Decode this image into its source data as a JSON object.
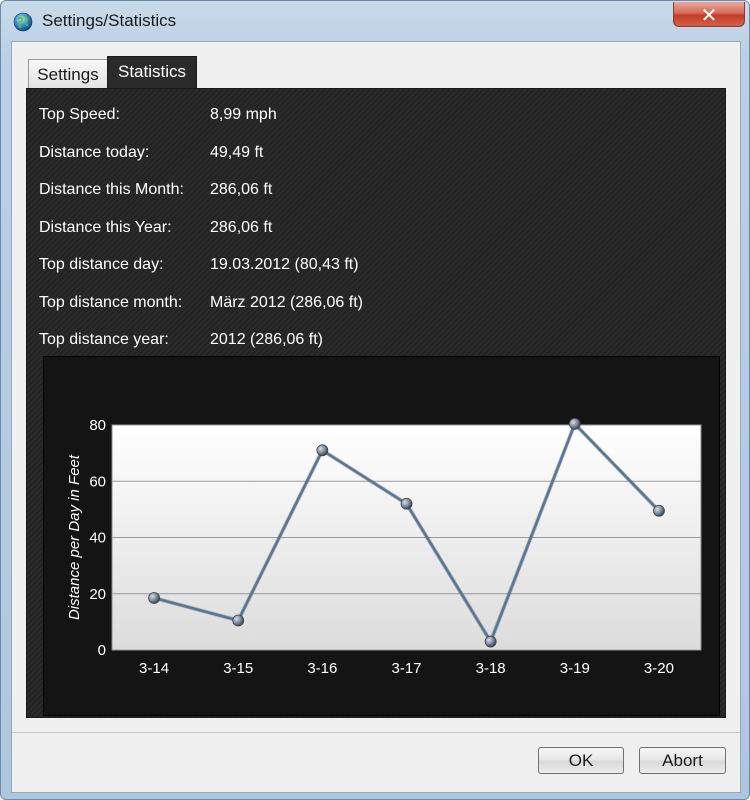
{
  "window": {
    "title": "Settings/Statistics",
    "close_glyph": "✕"
  },
  "tabs": [
    {
      "label": "Settings"
    },
    {
      "label": "Statistics"
    }
  ],
  "stats": [
    {
      "label": "Top Speed:",
      "value": "8,99 mph"
    },
    {
      "label": "Distance today:",
      "value": "49,49 ft"
    },
    {
      "label": "Distance this Month:",
      "value": "286,06 ft"
    },
    {
      "label": "Distance this Year:",
      "value": "286,06 ft"
    },
    {
      "label": "Top distance day:",
      "value": "19.03.2012 (80,43 ft)"
    },
    {
      "label": "Top distance month:",
      "value": "März 2012 (286,06 ft)"
    },
    {
      "label": "Top distance year:",
      "value": "2012 (286,06 ft)"
    }
  ],
  "chart_data": {
    "type": "line",
    "categories": [
      "3-14",
      "3-15",
      "3-16",
      "3-17",
      "3-18",
      "3-19",
      "3-20"
    ],
    "values": [
      18.5,
      10.5,
      71,
      52,
      3,
      80.4,
      49.5
    ],
    "ylabel": "Distance per Day in Feet",
    "xlabel": "",
    "ylim": [
      0,
      80
    ],
    "yticks": [
      0,
      20,
      40,
      60,
      80
    ],
    "grid": true,
    "line_color": "#5a7593",
    "marker_color": "#7e8b9b"
  },
  "buttons": {
    "ok": "OK",
    "abort": "Abort"
  },
  "colors": {
    "panel_bg": "#2a2a2a",
    "plot_bg": "#ffffff",
    "close_red": "#c43c26"
  }
}
